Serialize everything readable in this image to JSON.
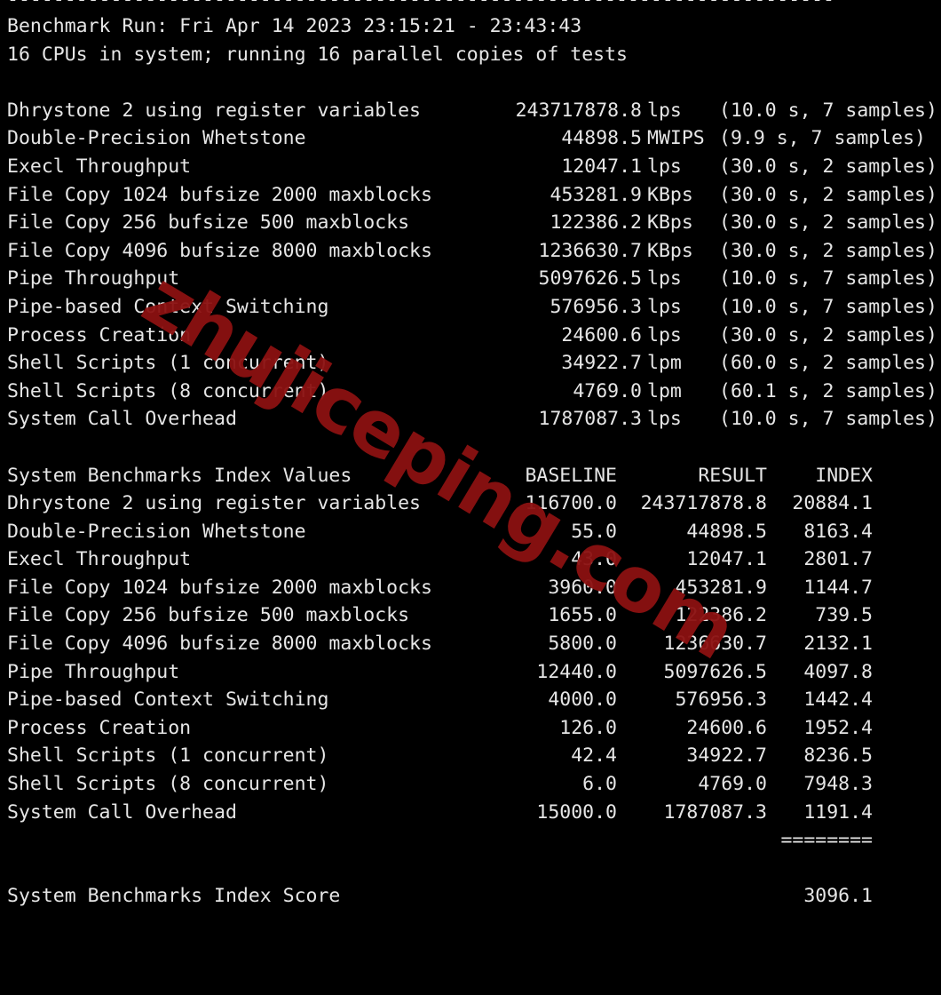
{
  "terminal": {
    "top_rule": "------------------------------------------------------------------------",
    "header": {
      "benchmark_run": "Benchmark Run: Fri Apr 14 2023 23:15:21 - 23:43:43",
      "cpu_line": "16 CPUs in system; running 16 parallel copies of tests"
    },
    "results": [
      {
        "name": "Dhrystone 2 using register variables",
        "value": "243717878.8",
        "unit": "lps",
        "samples": "(10.0 s, 7 samples)"
      },
      {
        "name": "Double-Precision Whetstone",
        "value": "44898.5",
        "unit": "MWIPS",
        "samples": "(9.9 s, 7 samples)"
      },
      {
        "name": "Execl Throughput",
        "value": "12047.1",
        "unit": "lps",
        "samples": "(30.0 s, 2 samples)"
      },
      {
        "name": "File Copy 1024 bufsize 2000 maxblocks",
        "value": "453281.9",
        "unit": "KBps",
        "samples": "(30.0 s, 2 samples)"
      },
      {
        "name": "File Copy 256 bufsize 500 maxblocks",
        "value": "122386.2",
        "unit": "KBps",
        "samples": "(30.0 s, 2 samples)"
      },
      {
        "name": "File Copy 4096 bufsize 8000 maxblocks",
        "value": "1236630.7",
        "unit": "KBps",
        "samples": "(30.0 s, 2 samples)"
      },
      {
        "name": "Pipe Throughput",
        "value": "5097626.5",
        "unit": "lps",
        "samples": "(10.0 s, 7 samples)"
      },
      {
        "name": "Pipe-based Context Switching",
        "value": "576956.3",
        "unit": "lps",
        "samples": "(10.0 s, 7 samples)"
      },
      {
        "name": "Process Creation",
        "value": "24600.6",
        "unit": "lps",
        "samples": "(30.0 s, 2 samples)"
      },
      {
        "name": "Shell Scripts (1 concurrent)",
        "value": "34922.7",
        "unit": "lpm",
        "samples": "(60.0 s, 2 samples)"
      },
      {
        "name": "Shell Scripts (8 concurrent)",
        "value": "4769.0",
        "unit": "lpm",
        "samples": "(60.1 s, 2 samples)"
      },
      {
        "name": "System Call Overhead",
        "value": "1787087.3",
        "unit": "lps",
        "samples": "(10.0 s, 7 samples)"
      }
    ],
    "index_table": {
      "title": "System Benchmarks Index Values",
      "columns": {
        "baseline": "BASELINE",
        "result": "RESULT",
        "index": "INDEX"
      },
      "rows": [
        {
          "name": "Dhrystone 2 using register variables",
          "baseline": "116700.0",
          "result": "243717878.8",
          "index": "20884.1"
        },
        {
          "name": "Double-Precision Whetstone",
          "baseline": "55.0",
          "result": "44898.5",
          "index": "8163.4"
        },
        {
          "name": "Execl Throughput",
          "baseline": "43.0",
          "result": "12047.1",
          "index": "2801.7"
        },
        {
          "name": "File Copy 1024 bufsize 2000 maxblocks",
          "baseline": "3960.0",
          "result": "453281.9",
          "index": "1144.7"
        },
        {
          "name": "File Copy 256 bufsize 500 maxblocks",
          "baseline": "1655.0",
          "result": "122386.2",
          "index": "739.5"
        },
        {
          "name": "File Copy 4096 bufsize 8000 maxblocks",
          "baseline": "5800.0",
          "result": "1236630.7",
          "index": "2132.1"
        },
        {
          "name": "Pipe Throughput",
          "baseline": "12440.0",
          "result": "5097626.5",
          "index": "4097.8"
        },
        {
          "name": "Pipe-based Context Switching",
          "baseline": "4000.0",
          "result": "576956.3",
          "index": "1442.4"
        },
        {
          "name": "Process Creation",
          "baseline": "126.0",
          "result": "24600.6",
          "index": "1952.4"
        },
        {
          "name": "Shell Scripts (1 concurrent)",
          "baseline": "42.4",
          "result": "34922.7",
          "index": "8236.5"
        },
        {
          "name": "Shell Scripts (8 concurrent)",
          "baseline": "6.0",
          "result": "4769.0",
          "index": "7948.3"
        },
        {
          "name": "System Call Overhead",
          "baseline": "15000.0",
          "result": "1787087.3",
          "index": "1191.4"
        }
      ],
      "separator": "========",
      "score_label": "System Benchmarks Index Score",
      "score_value": "3096.1"
    }
  },
  "watermark": {
    "text": "zhujiceping.com",
    "color": "#8c1111"
  },
  "colors": {
    "background": "#000000",
    "foreground": "#e6e6e6",
    "watermark": "#8c1111"
  }
}
